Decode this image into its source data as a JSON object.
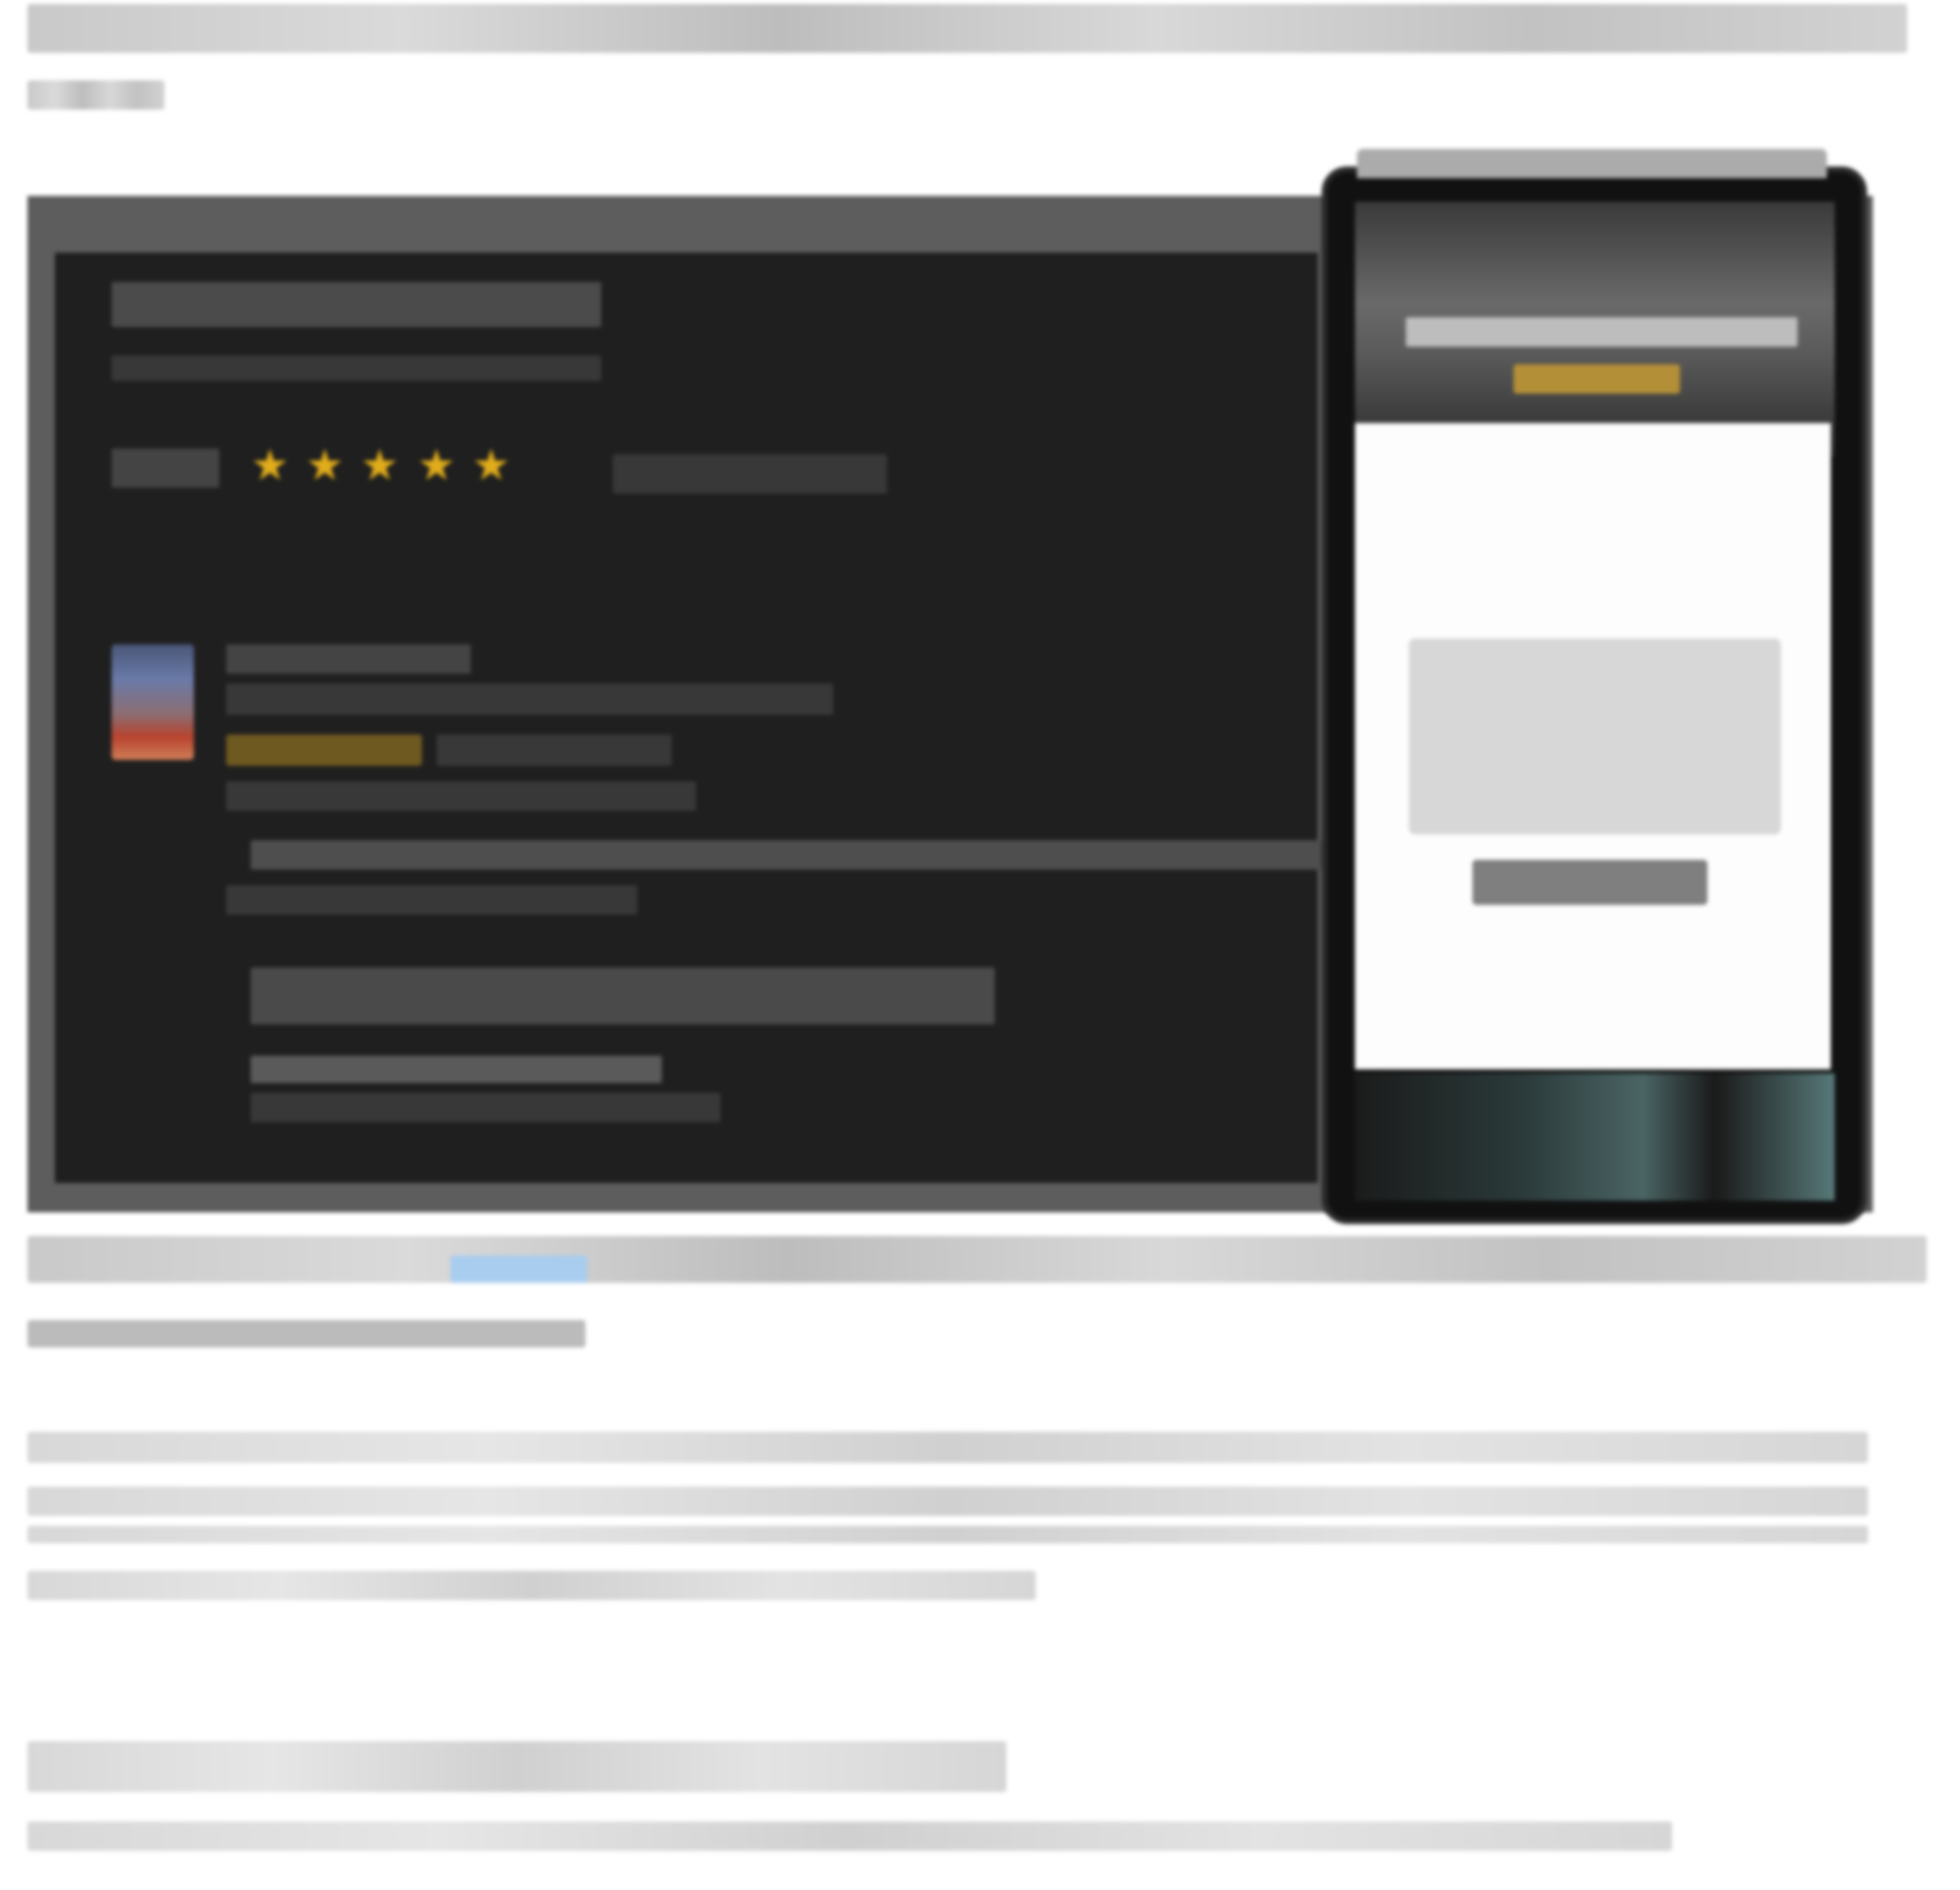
{
  "article": {
    "intro_line1": "",
    "intro_line2": "",
    "caption_line1": "",
    "caption_link": "",
    "caption_line2": "",
    "paragraph": "",
    "section_heading": "",
    "section_body": ""
  },
  "desktop_mock": {
    "title": "",
    "subtitle": "",
    "rating_stars": 5,
    "review_author": "",
    "review_meta": "",
    "review_title": "",
    "review_text": ""
  },
  "phone_mock": {
    "header_title": "",
    "modal_text": "",
    "modal_button": ""
  },
  "colors": {
    "page_bg": "#ffffff",
    "mock_bg": "#1f1f1f",
    "mock_frame": "#5d5d5d",
    "star": "#e0ac1b",
    "link": "#a9cdee",
    "phone_gold": "#b38f38"
  }
}
